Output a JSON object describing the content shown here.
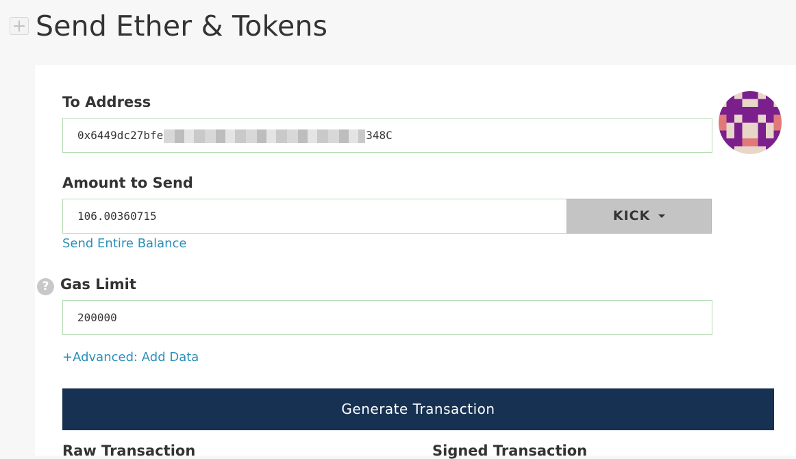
{
  "page": {
    "title": "Send Ether & Tokens"
  },
  "form": {
    "to_address": {
      "label": "To Address",
      "value_prefix": "0x6449dc27bfe",
      "value_suffix": "348C"
    },
    "amount": {
      "label": "Amount to Send",
      "value": "106.00360715",
      "token": "KICK",
      "send_entire_balance_link": "Send Entire Balance"
    },
    "gas_limit": {
      "label": "Gas Limit",
      "value": "200000",
      "help_glyph": "?"
    },
    "advanced_link": "+Advanced: Add Data",
    "generate_button": "Generate Transaction",
    "raw_transaction_label": "Raw Transaction",
    "signed_transaction_label": "Signed Transaction"
  },
  "icons": {
    "collapse": "plus-icon",
    "help": "question-circle-icon",
    "caret": "caret-down-icon",
    "identicon": "address-identicon"
  },
  "colors": {
    "link": "#2b8fb8",
    "primary_button": "#163151",
    "input_border": "#b5dcb3",
    "token_select_bg": "#c4c4c4",
    "identicon_primary": "#7a1f8c",
    "identicon_secondary": "#e8d6c8",
    "identicon_accent": "#e07a7a"
  }
}
